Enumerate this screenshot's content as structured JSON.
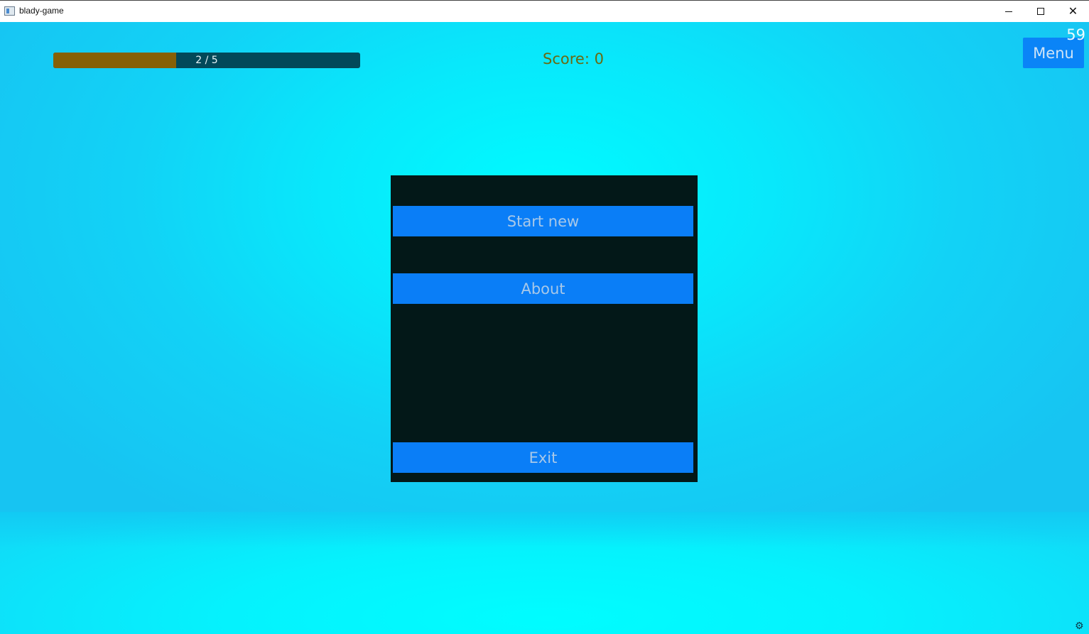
{
  "window": {
    "title": "blady-game",
    "minimize_icon": "minimize-icon",
    "maximize_icon": "maximize-icon",
    "close_icon": "close-icon",
    "close_glyph": "✕"
  },
  "hud": {
    "progress": {
      "current": 2,
      "total": 5,
      "fraction": 0.4,
      "label": "2 / 5"
    },
    "score_label": "Score: 0",
    "menu_label": "Menu",
    "fps": "59"
  },
  "main_menu": {
    "buttons": [
      {
        "label": "Start new"
      },
      {
        "label": "About"
      },
      {
        "label": "Exit"
      }
    ]
  },
  "corner": {
    "icon": "gear-icon",
    "glyph": "⚙"
  },
  "colors": {
    "sky": "#00fbff",
    "panel": "#031818",
    "button": "#0a7ef7",
    "progress_fill": "#866006",
    "progress_track": "#02495a",
    "score_text": "#6a6a10"
  }
}
